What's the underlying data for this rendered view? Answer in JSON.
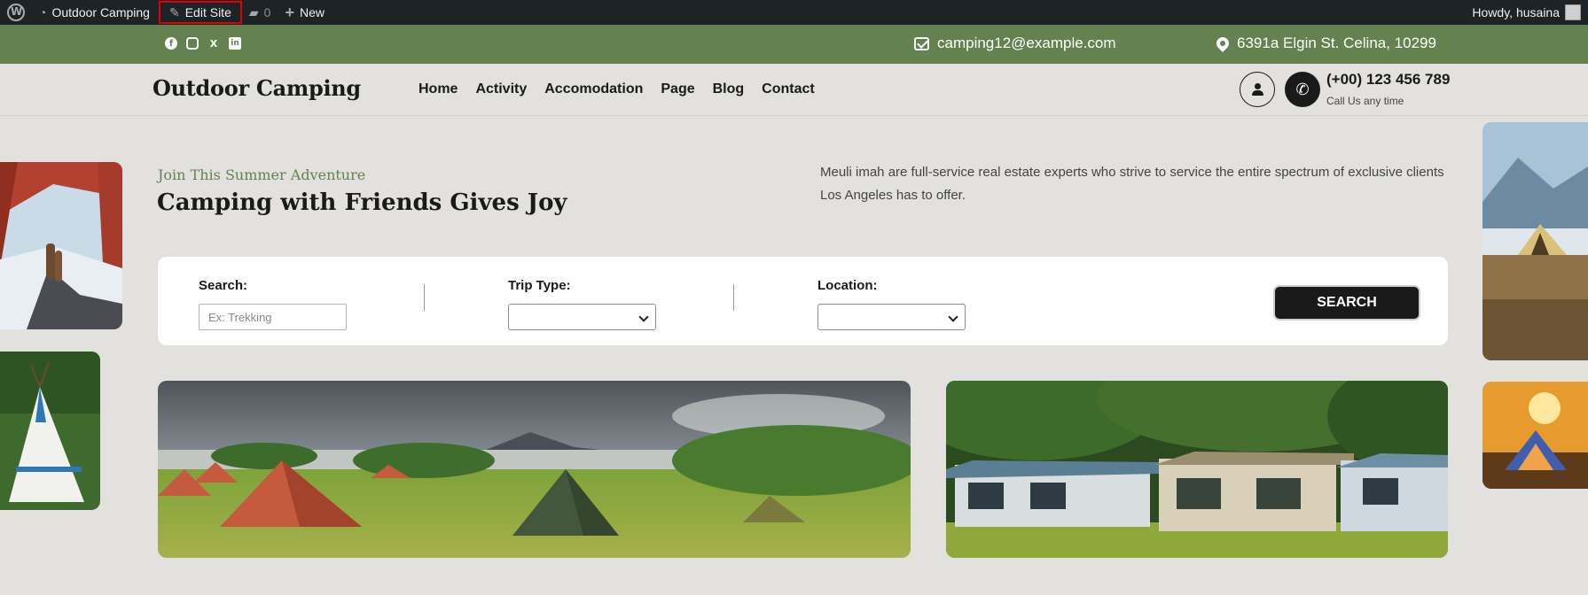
{
  "adminbar": {
    "site_name": "Outdoor Camping",
    "edit_site": "Edit Site",
    "comments_count": "0",
    "new_label": "New",
    "howdy": "Howdy, husaina"
  },
  "topbar": {
    "email": "camping12@example.com",
    "address": "6391a Elgin St. Celina, 10299"
  },
  "header": {
    "logo": "Outdoor Camping",
    "nav": [
      "Home",
      "Activity",
      "Accomodation",
      "Page",
      "Blog",
      "Contact"
    ],
    "phone": "(+00) 123 456 789",
    "phone_sub": "Call Us any time"
  },
  "hero": {
    "eyebrow": "Join This Summer Adventure",
    "title": "Camping with Friends Gives Joy",
    "description": "Meuli imah are full-service real estate experts who strive to service the entire spectrum of exclusive clients Los Angeles has to offer."
  },
  "search": {
    "search_label": "Search:",
    "search_placeholder": "Ex: Trekking",
    "trip_label": "Trip Type:",
    "trip_value": "",
    "location_label": "Location:",
    "location_value": "",
    "button": "SEARCH"
  },
  "colors": {
    "accent_green": "#64824f",
    "admin_bar": "#1d2327",
    "page_bg": "#e2e1de",
    "dark": "#1a1a1a"
  },
  "icons": [
    "wordpress-icon",
    "dashboard-icon",
    "edit-icon",
    "comment-icon",
    "plus-icon",
    "facebook-icon",
    "instagram-icon",
    "x-icon",
    "linkedin-icon",
    "mail-icon",
    "location-pin-icon",
    "user-icon",
    "phone-icon"
  ]
}
